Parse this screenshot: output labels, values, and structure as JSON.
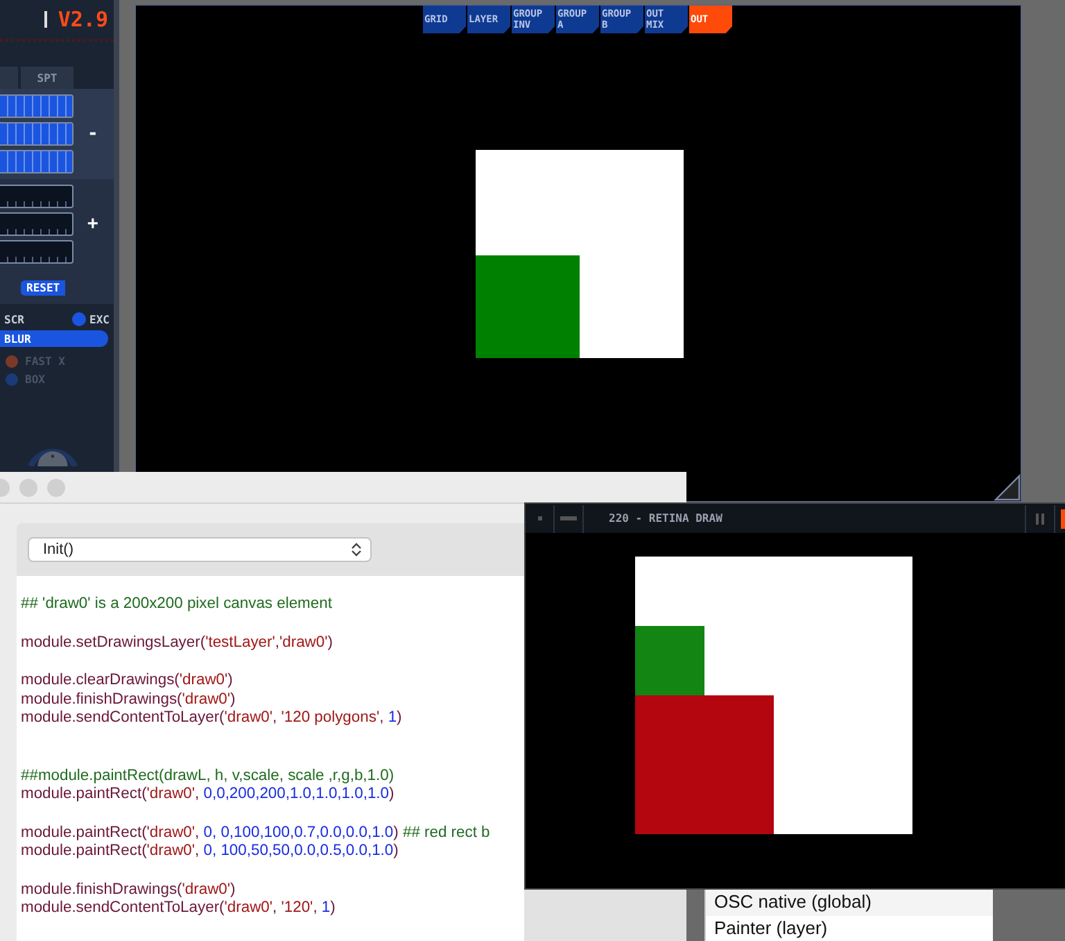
{
  "control_panel": {
    "version": "V2.9",
    "tabs": [
      {
        "label": "SPT",
        "selected": false
      }
    ],
    "sliders": [
      {
        "kind": "blue",
        "level": 1
      },
      {
        "kind": "blue",
        "level": 1
      },
      {
        "kind": "blue",
        "level": 1
      },
      {
        "kind": "dark",
        "level": 0
      },
      {
        "kind": "dark",
        "level": 0
      },
      {
        "kind": "dark",
        "level": 0
      }
    ],
    "minus_label": "-",
    "plus_label": "+",
    "reset_label": "RESET",
    "mode_label": "SCR",
    "modes": [
      {
        "label": "EXC",
        "selected": true
      }
    ],
    "options": [
      {
        "label": "BLUR",
        "selected": true,
        "color": "#1a55e0"
      },
      {
        "label": "FAST X",
        "selected": false,
        "disabled": true,
        "color": "#7a3a28"
      },
      {
        "label": "BOX",
        "selected": false,
        "disabled": true,
        "color": "#1c3a7a"
      }
    ]
  },
  "output_window": {
    "tabs": [
      {
        "label": "GRID",
        "selected": false
      },
      {
        "label": "LAYER",
        "selected": false
      },
      {
        "label": "GROUP INV",
        "selected": false
      },
      {
        "label": "GROUP A",
        "selected": false
      },
      {
        "label": "GROUP B",
        "selected": false
      },
      {
        "label": "OUT MIX",
        "selected": false
      },
      {
        "label": "OUT",
        "selected": true
      }
    ]
  },
  "editor": {
    "function_select": "Init()",
    "lines": [
      [
        {
          "kind": "comment",
          "t": "## 'draw0' is a 200x200 pixel canvas element"
        }
      ],
      [
        {
          "kind": "ident",
          "t": "module.setDrawingsLayer("
        },
        {
          "kind": "string",
          "t": "'testLayer'"
        },
        {
          "kind": "ident",
          "t": ","
        },
        {
          "kind": "string",
          "t": "'draw0'"
        },
        {
          "kind": "ident",
          "t": ")"
        }
      ],
      [
        {
          "kind": "ident",
          "t": "module.clearDrawings("
        },
        {
          "kind": "string",
          "t": "'draw0'"
        },
        {
          "kind": "ident",
          "t": ")"
        }
      ],
      [
        {
          "kind": "ident",
          "t": "module.finishDrawings("
        },
        {
          "kind": "string",
          "t": "'draw0'"
        },
        {
          "kind": "ident",
          "t": ")"
        }
      ],
      [
        {
          "kind": "ident",
          "t": "module.sendContentToLayer("
        },
        {
          "kind": "string",
          "t": "'draw0'"
        },
        {
          "kind": "ident",
          "t": ", "
        },
        {
          "kind": "string",
          "t": "'120 polygons'"
        },
        {
          "kind": "ident",
          "t": ", "
        },
        {
          "kind": "number",
          "t": "1"
        },
        {
          "kind": "ident",
          "t": ")"
        }
      ],
      [
        {
          "kind": "comment",
          "t": "##module.paintRect(drawL, h, v,scale, scale ,r,g,b,1.0)"
        }
      ],
      [
        {
          "kind": "ident",
          "t": "module.paintRect("
        },
        {
          "kind": "string",
          "t": "'draw0'"
        },
        {
          "kind": "ident",
          "t": ", "
        },
        {
          "kind": "number",
          "t": "0,0,200,200,1.0,1.0,1.0,1.0"
        },
        {
          "kind": "ident",
          "t": ")"
        }
      ],
      [
        {
          "kind": "ident",
          "t": "module.paintRect("
        },
        {
          "kind": "string",
          "t": "'draw0'"
        },
        {
          "kind": "ident",
          "t": ", "
        },
        {
          "kind": "number",
          "t": "0, 0,100,100,0.7,0.0,0.0,1.0"
        },
        {
          "kind": "ident",
          "t": ") "
        },
        {
          "kind": "comment",
          "t": "## red rect b"
        }
      ],
      [
        {
          "kind": "ident",
          "t": "module.paintRect("
        },
        {
          "kind": "string",
          "t": "'draw0'"
        },
        {
          "kind": "ident",
          "t": ", "
        },
        {
          "kind": "number",
          "t": "0, 100,50,50,0.0,0.5,0.0,1.0"
        },
        {
          "kind": "ident",
          "t": ")"
        }
      ],
      [
        {
          "kind": "ident",
          "t": "module.finishDrawings("
        },
        {
          "kind": "string",
          "t": "'draw0'"
        },
        {
          "kind": "ident",
          "t": ")"
        }
      ],
      [
        {
          "kind": "ident",
          "t": "module.sendContentToLayer("
        },
        {
          "kind": "string",
          "t": "'draw0'"
        },
        {
          "kind": "ident",
          "t": ", "
        },
        {
          "kind": "string",
          "t": "'120'"
        },
        {
          "kind": "ident",
          "t": ", "
        },
        {
          "kind": "number",
          "t": "1"
        },
        {
          "kind": "ident",
          "t": ")"
        }
      ]
    ]
  },
  "draw_window": {
    "title": "220 - RETINA DRAW"
  },
  "module_list": {
    "items": [
      {
        "label": "OSC native (global)"
      },
      {
        "label": "Painter (layer)"
      }
    ]
  }
}
